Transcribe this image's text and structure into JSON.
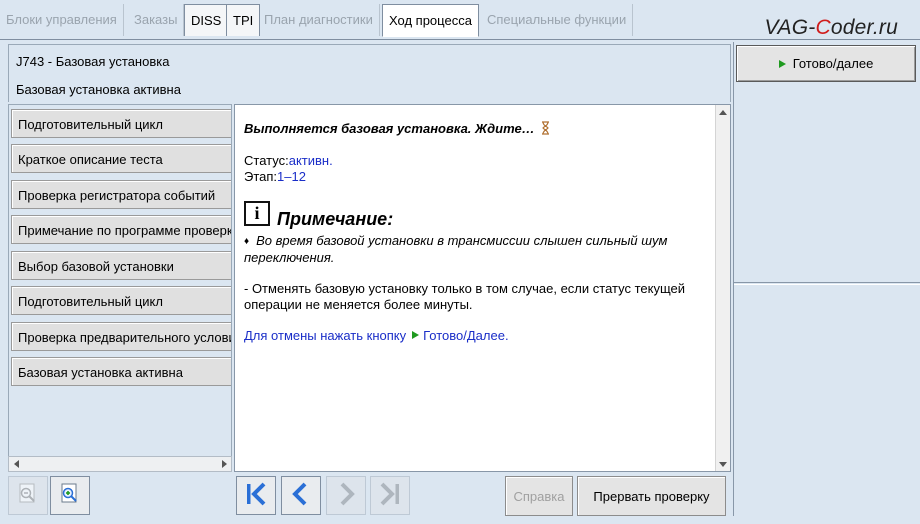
{
  "tabs": [
    {
      "label": "Блоки управления",
      "state": "disabled"
    },
    {
      "label": "Заказы",
      "state": "disabled"
    },
    {
      "label": "DISS",
      "state": "enabled"
    },
    {
      "label": "TPI",
      "state": "enabled"
    },
    {
      "label": "План диагностики",
      "state": "disabled"
    },
    {
      "label": "Ход процесса",
      "state": "active"
    },
    {
      "label": "Специальные функции",
      "state": "disabled"
    }
  ],
  "brand": {
    "before": "VAG-",
    "accent": "C",
    "after": "oder.ru",
    "accent_color": "#d01c1c"
  },
  "header": {
    "line1": "J743 - Базовая установка",
    "line2": "Базовая установка активна"
  },
  "right_panel": {
    "next_label": "Готово/далее"
  },
  "steps": [
    "Подготовительный цикл",
    "Краткое описание теста",
    "Проверка регистратора событий",
    "Примечание по программе проверки",
    "Выбор базовой установки",
    "Подготовительный цикл",
    "Проверка предварительного условия",
    "Базовая установка активна"
  ],
  "content": {
    "title": "Выполняется базовая установка. Ждите…",
    "status_label": "Статус:",
    "status_value": "активн.",
    "stage_label": "Этап:",
    "stage_value": "1–12",
    "note_icon_glyph": "i",
    "note_heading": "Примечание:",
    "bullet_glyph": "♦",
    "bullet_text": "Во время базовой установки в трансмиссии слышен сильный шум переключения.",
    "paragraph": "- Отменять базовую установку только в том случае, если статус текущей операции не меняется более минуты.",
    "cancel_prefix": "Для отмены нажать кнопку",
    "cancel_button_ref": "Готово/Далее."
  },
  "toolbar": {
    "help_label": "Справка",
    "abort_label": "Прервать проверку"
  },
  "colors": {
    "background": "#dbe6f1",
    "accent_blue": "#1a2ec8",
    "green_arrow": "#1f9a1f",
    "nav_blue": "#2a6fd6"
  },
  "icons": {
    "zoom_out": "zoom-out-icon",
    "zoom_in": "zoom-in-icon",
    "first": "skip-to-first-icon",
    "back": "back-icon",
    "forward": "forward-icon",
    "last": "skip-to-last-icon",
    "hourglass": "hourglass-icon",
    "note": "info-icon"
  }
}
